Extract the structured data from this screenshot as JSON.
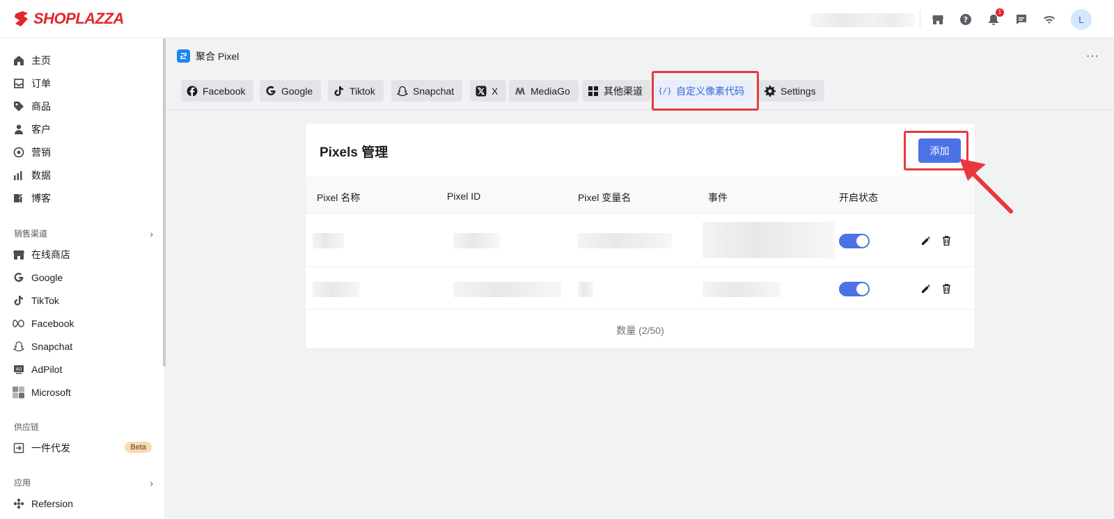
{
  "brand": {
    "name": "SHOPLAZZA",
    "color": "#e2252b"
  },
  "topbar": {
    "icons": [
      "store-icon",
      "help-icon",
      "bell-icon",
      "chat-icon",
      "wifi-icon"
    ],
    "notification_count": "1",
    "avatar_initial": "L"
  },
  "sidebar": {
    "main_items": [
      {
        "label": "主页",
        "icon": "home-icon"
      },
      {
        "label": "订单",
        "icon": "inbox-icon"
      },
      {
        "label": "商品",
        "icon": "tag-icon"
      },
      {
        "label": "客户",
        "icon": "person-icon"
      },
      {
        "label": "营销",
        "icon": "target-icon"
      },
      {
        "label": "数据",
        "icon": "bar-chart-icon"
      },
      {
        "label": "博客",
        "icon": "blog-icon"
      }
    ],
    "sales_channels_label": "销售渠道",
    "channel_items": [
      {
        "label": "在线商店",
        "icon": "store-icon"
      },
      {
        "label": "Google",
        "icon": "google-icon"
      },
      {
        "label": "TikTok",
        "icon": "tiktok-icon"
      },
      {
        "label": "Facebook",
        "icon": "meta-icon"
      },
      {
        "label": "Snapchat",
        "icon": "snapchat-icon"
      },
      {
        "label": "AdPilot",
        "icon": "ad-icon"
      },
      {
        "label": "Microsoft",
        "icon": "microsoft-icon"
      }
    ],
    "supply_chain_label": "供应链",
    "supply_items": [
      {
        "label": "一件代发",
        "icon": "dropship-icon",
        "badge": "Beta"
      }
    ],
    "apps_label": "应用",
    "app_items": [
      {
        "label": "Refersion",
        "icon": "refersion-icon"
      }
    ]
  },
  "page": {
    "app_title": "聚合 Pixel",
    "more_label": "···"
  },
  "tabs": [
    {
      "label": "Facebook",
      "icon": "facebook-icon",
      "active": false
    },
    {
      "label": "Google",
      "icon": "google-icon",
      "active": false
    },
    {
      "label": "Tiktok",
      "icon": "tiktok-icon",
      "active": false
    },
    {
      "label": "Snapchat",
      "icon": "snapchat-icon",
      "active": false
    },
    {
      "label": "X",
      "icon": "x-icon",
      "active": false
    },
    {
      "label": "MediaGo",
      "icon": "mediago-icon",
      "active": false
    },
    {
      "label": "其他渠道",
      "icon": "grid-icon",
      "active": false
    },
    {
      "label": "自定义像素代码",
      "icon": "code-icon",
      "active": true
    },
    {
      "label": "Settings",
      "icon": "gear-icon",
      "active": false
    }
  ],
  "card": {
    "title": "Pixels 管理",
    "add_label": "添加",
    "columns": [
      "Pixel 名称",
      "Pixel ID",
      "Pixel 变量名",
      "事件",
      "开启状态"
    ],
    "rows": [
      {
        "enabled": true
      },
      {
        "enabled": true
      }
    ],
    "count_text": "数量 (2/50)"
  },
  "colors": {
    "accent": "#4b73e6",
    "highlight": "#e8383e"
  }
}
